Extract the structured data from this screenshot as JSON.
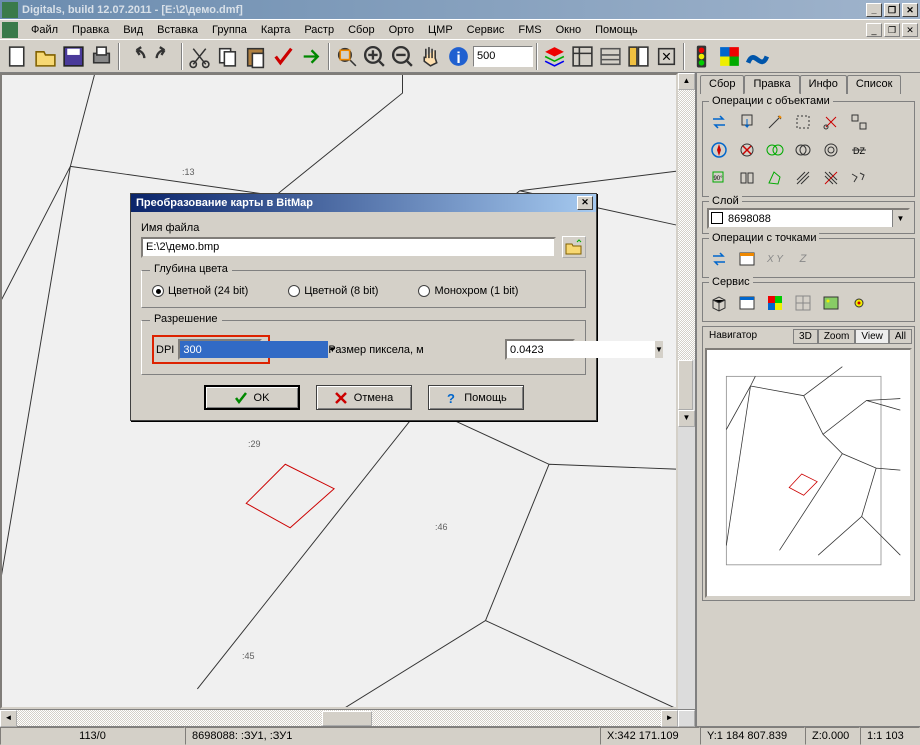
{
  "window": {
    "title": "Digitals, build 12.07.2011 - [E:\\2\\демо.dmf]"
  },
  "menu": {
    "items": [
      "Файл",
      "Правка",
      "Вид",
      "Вставка",
      "Группа",
      "Карта",
      "Растр",
      "Сбор",
      "Орто",
      "ЦМР",
      "Сервис",
      "FMS",
      "Окно",
      "Помощь"
    ]
  },
  "toolbar": {
    "scale_value": "500"
  },
  "sidepanel": {
    "tabs": [
      "Сбор",
      "Правка",
      "Инфо",
      "Список"
    ],
    "active_tab": 1,
    "ops_objects": "Операции с объектами",
    "layer_label": "Слой",
    "layer_value": "8698088",
    "ops_points": "Операции с точками",
    "pts_xy": "X Y",
    "pts_z": "Z",
    "service": "Сервис",
    "nav_label": "Навигатор",
    "nav_tabs": [
      "3D",
      "Zoom",
      "View",
      "All"
    ]
  },
  "dialog": {
    "title": "Преобразование карты в BitMap",
    "file_label": "Имя файла",
    "file_value": "E:\\2\\демо.bmp",
    "depth_label": "Глубина цвета",
    "depth_24": "Цветной (24 bit)",
    "depth_8": "Цветной (8 bit)",
    "depth_1": "Монохром (1 bit)",
    "res_label": "Разрешение",
    "dpi_label": "DPI",
    "dpi_value": "300",
    "px_label": "Размер пиксела, м",
    "px_value": "0.0423",
    "ok": "OK",
    "cancel": "Отмена",
    "help": "Помощь"
  },
  "canvas_labels": {
    "l13": ":13",
    "l29": ":29",
    "l46": ":46",
    "l45": ":45"
  },
  "status": {
    "cell1": "113/0",
    "cell2": "8698088: :ЗУ1, :ЗУ1",
    "cell3": "X:342 171.109",
    "cell4": "Y:1 184 807.839",
    "cell5": "Z:0.000",
    "cell6": "1:1 103"
  }
}
